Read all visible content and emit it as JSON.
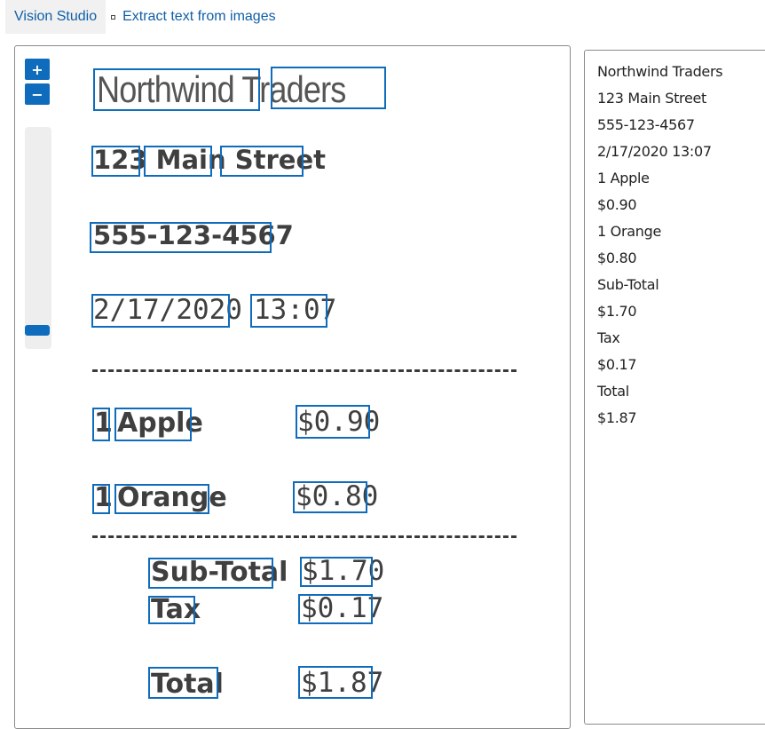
{
  "breadcrumb": {
    "home": "Vision Studio",
    "current": "Extract text from images"
  },
  "zoom": {
    "zoom_in": "+",
    "zoom_out": "−",
    "level": 0.93
  },
  "receipt": {
    "title": "Northwind Traders",
    "address": "123 Main Street",
    "phone": "555-123-4567",
    "date": "2/17/2020",
    "time": "13:07",
    "item1_qty": "1",
    "item1_name": "Apple",
    "item1_price": "$0.90",
    "item2_qty": "1",
    "item2_name": "Orange",
    "item2_price": "$0.80",
    "subtotal_label": "Sub-Total",
    "subtotal_value": "$1.70",
    "tax_label": "Tax",
    "tax_value": "$0.17",
    "total_label": "Total",
    "total_value": "$1.87"
  },
  "results": [
    "Northwind Traders",
    "123 Main Street",
    "555-123-4567",
    "2/17/2020 13:07",
    "1 Apple",
    "$0.90",
    "1 Orange",
    "$0.80",
    "Sub-Total",
    "$1.70",
    "Tax",
    "$0.17",
    "Total",
    "$1.87"
  ],
  "colors": {
    "accent": "#0f6cbd",
    "link": "#0f5fa8",
    "receipt_text": "#3f3f3f"
  }
}
